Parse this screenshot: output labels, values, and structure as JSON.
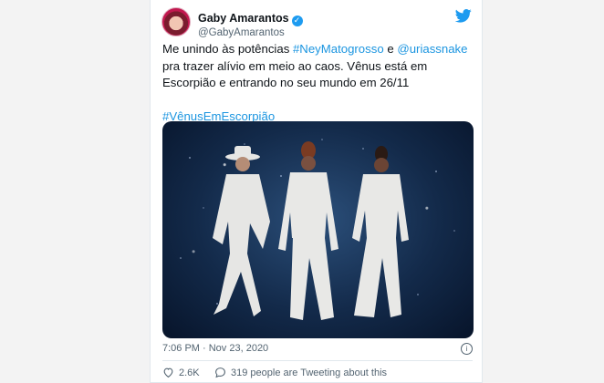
{
  "tweet": {
    "display_name": "Gaby Amarantos",
    "handle": "@GabyAmarantos",
    "text_parts": [
      {
        "type": "text",
        "value": "Me unindo às potências "
      },
      {
        "type": "tag",
        "value": "#NeyMatogrosso"
      },
      {
        "type": "text",
        "value": " e "
      },
      {
        "type": "tag",
        "value": "@uriassnake"
      },
      {
        "type": "text",
        "value": " pra trazer alívio em meio ao caos. Vênus está em Escorpião e entrando no seu mundo em 26/11"
      }
    ],
    "hashtag": "#VênusEmEscorpião",
    "timestamp": "7:06 PM · Nov 23, 2020",
    "likes": "2.6K",
    "tweeting_about": "319 people are Tweeting about this"
  },
  "icons": {
    "verified": "verified-badge-icon",
    "logo": "twitter-bird-icon",
    "info": "info-icon",
    "like": "heart-icon",
    "comment": "speech-bubble-icon"
  },
  "colors": {
    "link": "#1b95e0",
    "verified": "#1d9bf0",
    "muted": "#536471"
  }
}
